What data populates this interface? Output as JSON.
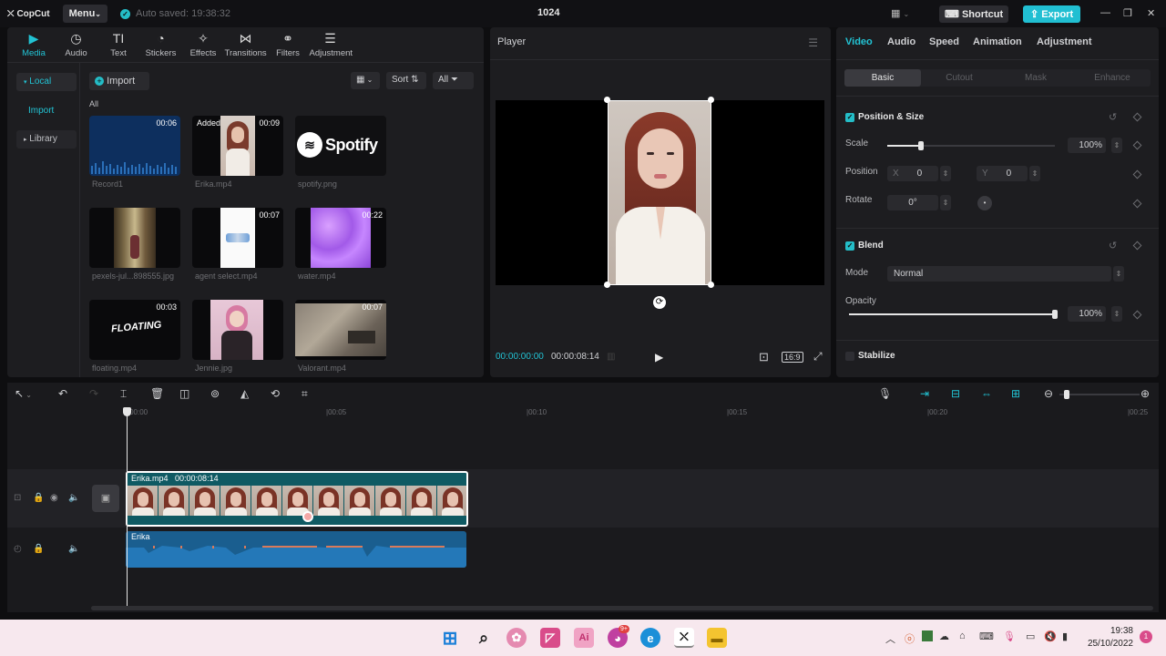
{
  "titlebar": {
    "app_name": "CopCut",
    "menu_label": "Menu",
    "autosave_text": "Auto saved: 19:38:32",
    "project_title": "1024",
    "shortcut_label": "Shortcut",
    "export_label": "Export"
  },
  "media_toolbar": {
    "tabs": [
      {
        "label": "Media",
        "icon": "media-icon",
        "glyph": "▶"
      },
      {
        "label": "Audio",
        "icon": "audio-icon",
        "glyph": "◷"
      },
      {
        "label": "Text",
        "icon": "text-icon",
        "glyph": "TI"
      },
      {
        "label": "Stickers",
        "icon": "sticker-icon",
        "glyph": "◔"
      },
      {
        "label": "Effects",
        "icon": "effects-icon",
        "glyph": "✧"
      },
      {
        "label": "Transitions",
        "icon": "transitions-icon",
        "glyph": "⋈"
      },
      {
        "label": "Filters",
        "icon": "filters-icon",
        "glyph": "⚭"
      },
      {
        "label": "Adjustment",
        "icon": "adjustment-icon",
        "glyph": "☰"
      }
    ]
  },
  "sidebar": {
    "local": "Local",
    "import": "Import",
    "library": "Library"
  },
  "media": {
    "import_label": "Import",
    "sort_label": "Sort",
    "all_filter": "All",
    "all_heading": "All",
    "items": [
      {
        "name": "Record1",
        "duration": "00:06"
      },
      {
        "name": "Erika.mp4",
        "duration": "00:09",
        "badge": "Added"
      },
      {
        "name": "spotify.png",
        "duration": "",
        "thumb_text": "Spotify"
      },
      {
        "name": "pexels-jul...898555.jpg",
        "duration": ""
      },
      {
        "name": "agent select.mp4",
        "duration": "00:07"
      },
      {
        "name": "water.mp4",
        "duration": "00:22"
      },
      {
        "name": "floating.mp4",
        "duration": "00:03",
        "thumb_text": "FLOATING"
      },
      {
        "name": "Jennie.jpg",
        "duration": ""
      },
      {
        "name": "Valorant.mp4",
        "duration": "00:07"
      }
    ]
  },
  "player": {
    "title": "Player",
    "current_time": "00:00:00:00",
    "total_time": "00:00:08:14",
    "ratio": "16:9"
  },
  "right_panel": {
    "tabs": [
      "Video",
      "Audio",
      "Speed",
      "Animation",
      "Adjustment"
    ],
    "subtabs": [
      "Basic",
      "Cutout",
      "Mask",
      "Enhance"
    ],
    "position_size_title": "Position & Size",
    "scale_label": "Scale",
    "scale_value": "100%",
    "scale_fraction": 0.2,
    "position_label": "Position",
    "x_label": "X",
    "x_value": "0",
    "y_label": "Y",
    "y_value": "0",
    "rotate_label": "Rotate",
    "rotate_value": "0°",
    "blend_title": "Blend",
    "mode_label": "Mode",
    "mode_value": "Normal",
    "opacity_label": "Opacity",
    "opacity_value": "100%",
    "opacity_fraction": 1.0,
    "stabilize_title": "Stabilize"
  },
  "timeline": {
    "ruler": [
      "|00:00",
      "|00:05",
      "|00:10",
      "|00:15",
      "|00:20",
      "|00:25"
    ],
    "video_clip_name": "Erika.mp4",
    "video_clip_duration": "00:00:08:14",
    "audio_clip_name": "Erika"
  },
  "taskbar": {
    "time": "19:38",
    "date": "25/10/2022",
    "notification_badge": "9+",
    "notif_count": "1"
  },
  "colors": {
    "accent": "#22c3d4",
    "panel_bg": "#1d1d20",
    "clip_bg": "#0f5a63",
    "audio_bg": "#1a5e8f",
    "taskbar_bg": "#f7e8ee"
  }
}
